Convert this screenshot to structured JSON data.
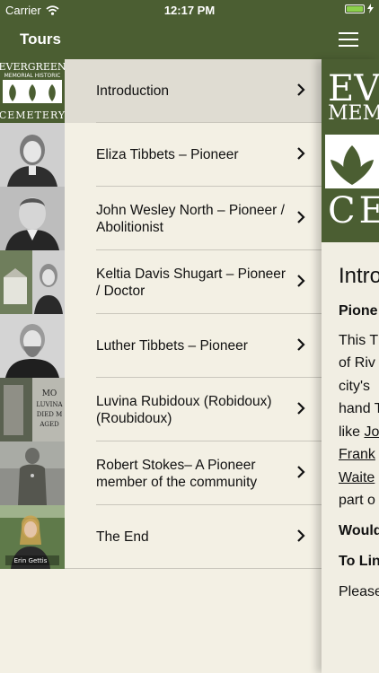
{
  "status_bar": {
    "carrier": "Carrier",
    "time": "12:17 PM",
    "battery_percent": 100
  },
  "nav": {
    "title": "Tours"
  },
  "tours": [
    {
      "label": "Introduction",
      "thumb": "evergreen-logo"
    },
    {
      "label": "Eliza Tibbets – Pioneer",
      "thumb": "portrait"
    },
    {
      "label": "John Wesley North – Pioneer / Abolitionist",
      "thumb": "portrait"
    },
    {
      "label": "Keltia Davis Shugart – Pioneer / Doctor",
      "thumb": "portrait"
    },
    {
      "label": "Luther Tibbets – Pioneer",
      "thumb": "portrait"
    },
    {
      "label": "Luvina Rubidoux (Robidoux) (Roubidoux)",
      "thumb": "headstone"
    },
    {
      "label": "Robert Stokes– A Pioneer member of the community",
      "thumb": "statue"
    },
    {
      "label": "The End",
      "thumb": "video"
    }
  ],
  "thumb_texts": {
    "logo_line1": "EVERGREEN",
    "logo_line2": "MEMORIAL HISTORIC",
    "logo_line3": "CEMETERY",
    "headstone": "MO\nLUVINA\nDIED M\nAGED",
    "video_caption": "Erin Gettis"
  },
  "detail": {
    "logo_line1": "EVER",
    "logo_line2": "MEMO",
    "logo_line3": "CEM",
    "title": "Intro",
    "heading": "Pione",
    "para_lines": [
      "This T",
      "of Riv",
      "city's",
      "hand T",
      "like ",
      "Frank",
      "Waite",
      "part o"
    ],
    "link_words": [
      "Jo",
      "",
      ""
    ],
    "would": "Would",
    "to_link": "To Lin",
    "please": "Please"
  }
}
